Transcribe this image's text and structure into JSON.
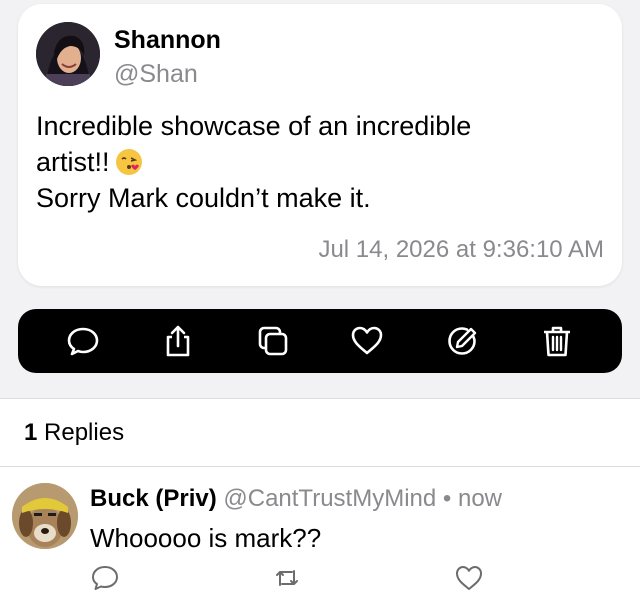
{
  "post": {
    "author_name": "Shannon",
    "author_handle": "@Shan",
    "body_line1": "Incredible showcase of an incredible",
    "body_line2": "artist!!",
    "body_emoji": "face-blowing-a-kiss",
    "body_line3": "Sorry Mark couldn’t make it.",
    "timestamp": "Jul 14, 2026 at 9:36:10 AM"
  },
  "action_bar": {
    "items": [
      {
        "icon": "comment-icon"
      },
      {
        "icon": "share-icon"
      },
      {
        "icon": "copy-icon"
      },
      {
        "icon": "heart-icon"
      },
      {
        "icon": "edit-icon"
      },
      {
        "icon": "trash-icon"
      }
    ]
  },
  "replies": {
    "count_number": "1",
    "count_label": "Replies",
    "items": [
      {
        "name": "Buck (Priv)",
        "handle": "@CantTrustMyMind",
        "separator": "•",
        "time": "now",
        "body": "Whooooo is mark??",
        "actions": [
          "comment-icon",
          "repost-icon",
          "heart-icon"
        ]
      }
    ]
  },
  "colors": {
    "background": "#f2f2f4",
    "card": "#ffffff",
    "secondary_text": "#8a8a8e",
    "action_bar": "#000000"
  }
}
